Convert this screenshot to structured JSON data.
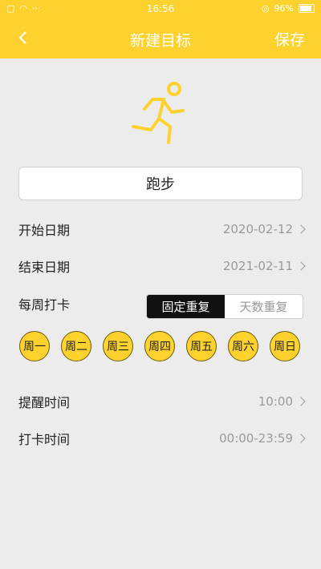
{
  "status": {
    "time": "16:56",
    "battery": "96%"
  },
  "nav": {
    "title": "新建目标",
    "save_label": "保存"
  },
  "goal": {
    "name": "跑步"
  },
  "start_date": {
    "label": "开始日期",
    "value": "2020-02-12"
  },
  "end_date": {
    "label": "结束日期",
    "value": "2021-02-11"
  },
  "weekly": {
    "label": "每周打卡",
    "mode_fixed": "固定重复",
    "mode_days": "天数重复",
    "days": [
      "周一",
      "周二",
      "周三",
      "周四",
      "周五",
      "周六",
      "周日"
    ]
  },
  "reminder": {
    "label": "提醒时间",
    "value": "10:00"
  },
  "checkin": {
    "label": "打卡时间",
    "value": "00:00-23:59"
  },
  "colors": {
    "accent": "#fdd22e",
    "selected": "#111111"
  }
}
